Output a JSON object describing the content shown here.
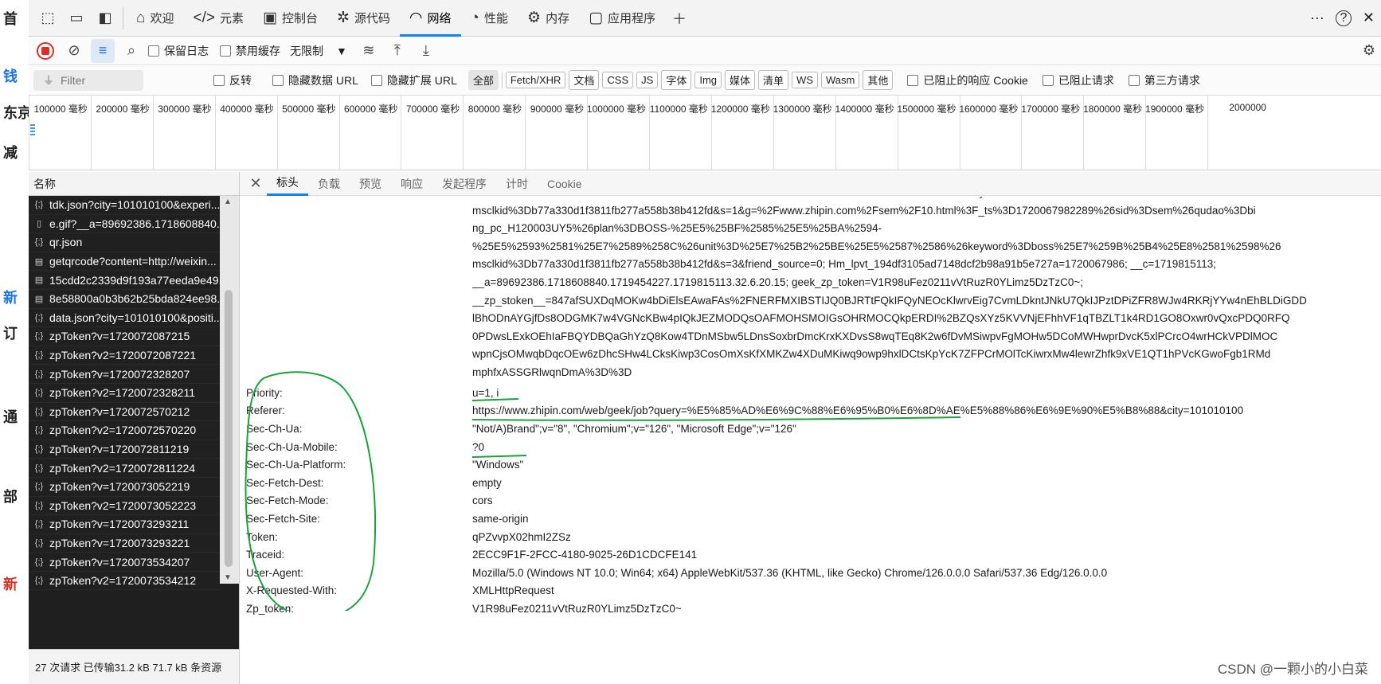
{
  "page_left_fragments": [
    "首",
    "钱",
    "东京",
    "减",
    "新",
    "订",
    "通",
    "部",
    "新"
  ],
  "tabs": [
    {
      "label": "欢迎",
      "icon": "home-icon"
    },
    {
      "label": "元素",
      "icon": "code-icon"
    },
    {
      "label": "控制台",
      "icon": "console-icon"
    },
    {
      "label": "源代码",
      "icon": "bug-icon"
    },
    {
      "label": "网络",
      "icon": "wifi-icon"
    },
    {
      "label": "性能",
      "icon": "performance-icon"
    },
    {
      "label": "内存",
      "icon": "memory-icon"
    },
    {
      "label": "应用程序",
      "icon": "application-icon"
    }
  ],
  "toolbar": {
    "preserve_log": "保留日志",
    "disable_cache": "禁用缓存",
    "throttle": "无限制"
  },
  "filterbar": {
    "placeholder": "Filter",
    "invert": "反转",
    "hide_data_urls": "隐藏数据 URL",
    "hide_ext_urls": "隐藏扩展 URL",
    "types": [
      "全部",
      "Fetch/XHR",
      "文档",
      "CSS",
      "JS",
      "字体",
      "Img",
      "媒体",
      "清单",
      "WS",
      "Wasm",
      "其他"
    ],
    "blocked_cookies": "已阻止的响应 Cookie",
    "blocked_requests": "已阻止请求",
    "third_party": "第三方请求"
  },
  "overview": {
    "ticks": [
      "100000 毫秒",
      "200000 毫秒",
      "300000 毫秒",
      "400000 毫秒",
      "500000 毫秒",
      "600000 毫秒",
      "700000 毫秒",
      "800000 毫秒",
      "900000 毫秒",
      "1000000 毫秒",
      "1100000 毫秒",
      "1200000 毫秒",
      "1300000 毫秒",
      "1400000 毫秒",
      "1500000 毫秒",
      "1600000 毫秒",
      "1700000 毫秒",
      "1800000 毫秒",
      "1900000 毫秒",
      "2000000"
    ]
  },
  "reqlist": {
    "header": "名称",
    "items": [
      {
        "name": "tdk.json?city=101010100&experi...",
        "icon": "xhr"
      },
      {
        "name": "e.gif?__a=89692386.1718608840....",
        "icon": "doc"
      },
      {
        "name": "qr.json",
        "icon": "xhr"
      },
      {
        "name": "getqrcode?content=http://weixin...",
        "icon": "img"
      },
      {
        "name": "15cdd2c2339d9f193a77eeda9e49...",
        "icon": "img"
      },
      {
        "name": "8e58800a0b3b62b25bda824ee98...",
        "icon": "img"
      },
      {
        "name": "data.json?city=101010100&positi...",
        "icon": "xhr"
      },
      {
        "name": "zpToken?v=1720072087215",
        "icon": "xhr"
      },
      {
        "name": "zpToken?v2=1720072087221",
        "icon": "xhr"
      },
      {
        "name": "zpToken?v=1720072328207",
        "icon": "xhr"
      },
      {
        "name": "zpToken?v2=1720072328211",
        "icon": "xhr"
      },
      {
        "name": "zpToken?v=1720072570212",
        "icon": "xhr"
      },
      {
        "name": "zpToken?v2=1720072570220",
        "icon": "xhr"
      },
      {
        "name": "zpToken?v=1720072811219",
        "icon": "xhr"
      },
      {
        "name": "zpToken?v2=1720072811224",
        "icon": "xhr"
      },
      {
        "name": "zpToken?v=1720073052219",
        "icon": "xhr"
      },
      {
        "name": "zpToken?v2=1720073052223",
        "icon": "xhr"
      },
      {
        "name": "zpToken?v=1720073293211",
        "icon": "xhr"
      },
      {
        "name": "zpToken?v=1720073293221",
        "icon": "xhr"
      },
      {
        "name": "zpToken?v=1720073534207",
        "icon": "xhr"
      },
      {
        "name": "zpToken?v2=1720073534212",
        "icon": "xhr"
      }
    ],
    "footer": "27 次请求  已传输31.2 kB  71.7 kB 条资源"
  },
  "detail": {
    "tabs": [
      "标头",
      "负载",
      "预览",
      "响应",
      "发起程序",
      "计时",
      "Cookie"
    ],
    "cookie_lines": [
      "%25E5%2593%2581%25E7%2589%258C%26unit%3D%25E7%25B2%25BE%25E5%2587%2586%26keyword%3Dboss%25E7%259B%25B4%25E8%2581%2598%26",
      "msclkid%3Db77a330d1f3811fb277a558b38b412fd&s=1&g=%2Fwww.zhipin.com%2Fsem%2F10.html%3F_ts%3D1720067982289%26sid%3Dsem%26qudao%3Dbi",
      "ng_pc_H120003UY5%26plan%3DBOSS-%25E5%25BF%2585%25E5%25BA%2594-",
      "%25E5%2593%2581%25E7%2589%258C%26unit%3D%25E7%25B2%25BE%25E5%2587%2586%26keyword%3Dboss%25E7%259B%25B4%25E8%2581%2598%26",
      "msclkid%3Db77a330d1f3811fb277a558b38b412fd&s=3&friend_source=0; Hm_lpvt_194df3105ad7148dcf2b98a91b5e727a=1720067986; __c=1719815113;",
      "__a=89692386.1718608840.1719454227.1719815113.32.6.20.15; geek_zp_token=V1R98uFez0211vVtRuzR0YLimz5DzTzC0~;",
      "__zp_stoken__=847afSUXDqMOKw4bDiElsEAwaFAs%2FNERFMXIBSTIJQ0BJRTtFQkIFQyNEOcKlwrvEig7CvmLDkntJNkU7QkIJPztDPiZFR8WJw4RKRjYYw4nEhBLDiGDD",
      "lBhODnAYGjfDs8ODGMK7w4VGNcKBw4pIQkJEZMODQsOAFMOHSMOIGsOHRMOCQkpERDI%2BZQsXYz5KVVNjEFhhVF1qTBZLT1k4RD1GO8Oxwr0vQxcPDQ0RFQ",
      "0PDwsLExkOEhIaFBQYDBQaGhYzQ8Kow4TDnMSbw5LDnsSoxbrDmcKrxKXDvsS8wqTEq8K2w6fDvMSiwpvFgMOHw5DCoMWHwprDvcK5xlPCrcO4wrHCkVPDlMOC",
      "wpnCjsOMwqbDqcOEw6zDhcSHw4LCksKiwp3CosOmXsKfXMKZw4XDuMKiwq9owp9hxlDCtsKpYcK7ZFPCrMOlTcKiwrxMw4lewrZhfk9xVE1QT1hPVcKGwoFgb1RMd",
      "mphfxASSGRlwqnDmA%3D%3D"
    ],
    "headers": [
      {
        "name": "Priority:",
        "value": "u=1, i"
      },
      {
        "name": "Referer:",
        "value": "https://www.zhipin.com/web/geek/job?query=%E5%85%AD%E6%9C%88%E6%95%B0%E6%8D%AE%E5%88%86%E6%9E%90%E5%B8%88&city=101010100"
      },
      {
        "name": "Sec-Ch-Ua:",
        "value": "\"Not/A)Brand\";v=\"8\", \"Chromium\";v=\"126\", \"Microsoft Edge\";v=\"126\""
      },
      {
        "name": "Sec-Ch-Ua-Mobile:",
        "value": "?0"
      },
      {
        "name": "Sec-Ch-Ua-Platform:",
        "value": "\"Windows\""
      },
      {
        "name": "Sec-Fetch-Dest:",
        "value": "empty"
      },
      {
        "name": "Sec-Fetch-Mode:",
        "value": "cors"
      },
      {
        "name": "Sec-Fetch-Site:",
        "value": "same-origin"
      },
      {
        "name": "Token:",
        "value": "qPZvvpX02hmI2ZSz"
      },
      {
        "name": "Traceid:",
        "value": "2ECC9F1F-2FCC-4180-9025-26D1CDCFE141"
      },
      {
        "name": "User-Agent:",
        "value": "Mozilla/5.0 (Windows NT 10.0; Win64; x64) AppleWebKit/537.36 (KHTML, like Gecko) Chrome/126.0.0.0 Safari/537.36 Edg/126.0.0.0"
      },
      {
        "name": "X-Requested-With:",
        "value": "XMLHttpRequest"
      },
      {
        "name": "Zp_token:",
        "value": "V1R98uFez0211vVtRuzR0YLimz5DzTzC0~"
      }
    ]
  },
  "watermark": "CSDN @一颗小的小白菜",
  "colors": {
    "accent": "#0a84ff",
    "annotation": "#1aa33c",
    "record": "#d93025"
  }
}
